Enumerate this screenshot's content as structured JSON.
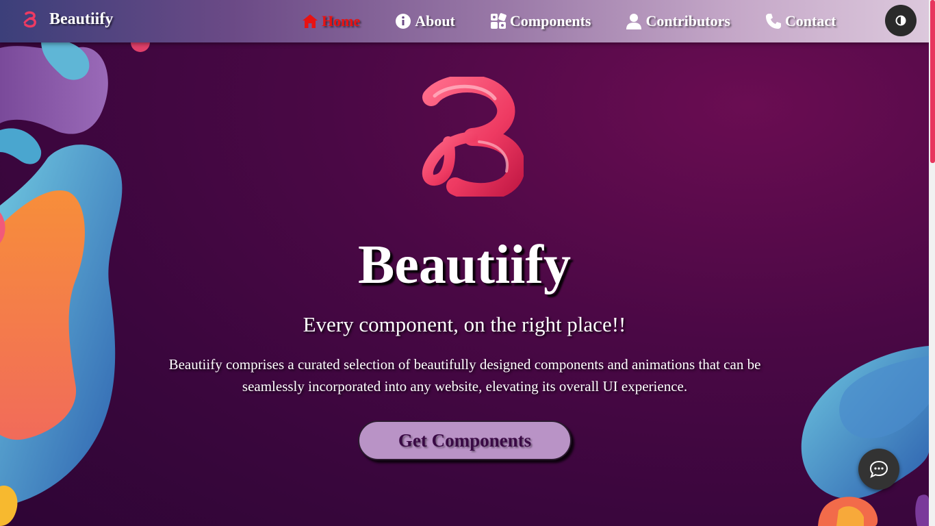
{
  "navbar": {
    "brand_name": "Beautiify",
    "items": [
      {
        "label": "Home",
        "icon": "home-icon",
        "active": true
      },
      {
        "label": "About",
        "icon": "info-icon",
        "active": false
      },
      {
        "label": "Components",
        "icon": "components-icon",
        "active": false
      },
      {
        "label": "Contributors",
        "icon": "user-icon",
        "active": false
      },
      {
        "label": "Contact",
        "icon": "phone-icon",
        "active": false
      }
    ],
    "theme_toggle_icon": "half-circle-icon"
  },
  "hero": {
    "title": "Beautiify",
    "subtitle": "Every component, on the right place!!",
    "description": "Beautiify comprises a curated selection of beautifully designed components and animations that can be seamlessly incorporated into any website, elevating its overall UI experience.",
    "cta_label": "Get Components"
  },
  "chat_button_icon": "chat-bubble-icon",
  "colors": {
    "active_nav": "#e81212",
    "cta_background": "#b993c6",
    "cta_text": "#3a0a45",
    "logo_pink": "#ee3a62",
    "scroll_thumb": "#e8365d"
  }
}
